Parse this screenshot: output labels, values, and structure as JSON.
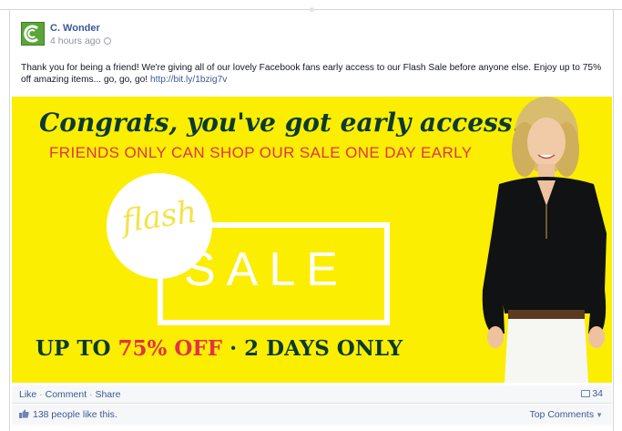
{
  "post": {
    "page_name": "C. Wonder",
    "timestamp": "4 hours ago",
    "text": "Thank you for being a friend! We're giving all of our lovely Facebook fans early access to our Flash Sale before anyone else. Enjoy up to 75% off amazing items... go, go, go!",
    "link": "http://bit.ly/1bzig7v"
  },
  "banner": {
    "headline": "Congrats, you've got early access.",
    "subhead": "FRIENDS ONLY CAN SHOP OUR SALE ONE DAY EARLY",
    "flash": "flash",
    "sale": "SALE",
    "offer_prefix": "UP TO ",
    "offer_pct": "75% OFF",
    "offer_suffix": " · 2 DAYS ONLY"
  },
  "actions": {
    "like": "Like",
    "comment": "Comment",
    "share": "Share",
    "separator": "·",
    "share_count": "34"
  },
  "likes": {
    "text": "138 people like this.",
    "top_comments": "Top Comments"
  },
  "colors": {
    "banner_bg": "#fbee00",
    "headline": "#0b3a32",
    "accent_red": "#e3324a",
    "link_blue": "#3b5998",
    "brand_green": "#5aa53a"
  },
  "icons": [
    "globe-icon",
    "share-icon",
    "thumb-icon",
    "caret-icon"
  ]
}
